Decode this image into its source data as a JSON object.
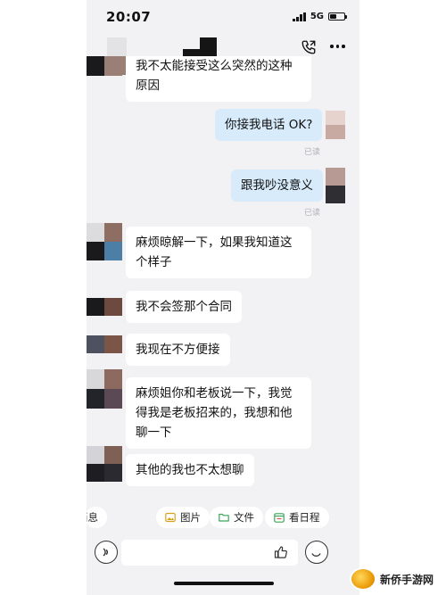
{
  "status_bar": {
    "time": "20:07",
    "network": "5G"
  },
  "messages": [
    {
      "direction": "in",
      "text": "我不太能接受这么突然的这种\n原因"
    },
    {
      "direction": "out",
      "text": "你接我电话 OK?",
      "receipt": "已读"
    },
    {
      "direction": "out",
      "text": "跟我吵没意义",
      "receipt": "已读"
    },
    {
      "direction": "in",
      "text": "麻烦晾解一下，如果我知道这\n个样子"
    },
    {
      "direction": "in",
      "text": "我不会签那个合同"
    },
    {
      "direction": "in",
      "text": "我现在不方便接"
    },
    {
      "direction": "in",
      "text": "麻烦姐你和老板说一下，我觉\n得我是老板招来的，我想和他\n聊一下"
    },
    {
      "direction": "in",
      "text": "其他的我也不太想聊"
    }
  ],
  "toolbar": {
    "items": [
      {
        "label": "消息",
        "icon": "message-icon"
      },
      {
        "label": "图片",
        "icon": "image-icon"
      },
      {
        "label": "文件",
        "icon": "folder-icon"
      },
      {
        "label": "看日程",
        "icon": "calendar-icon"
      }
    ]
  },
  "input": {
    "placeholder": ""
  },
  "watermark": {
    "text": "新侨手游网"
  },
  "colors": {
    "background": "#f2f2f4",
    "incoming_bubble": "#ffffff",
    "outgoing_bubble": "#d7ebfb",
    "read_receipt": "#b0b0b6"
  }
}
